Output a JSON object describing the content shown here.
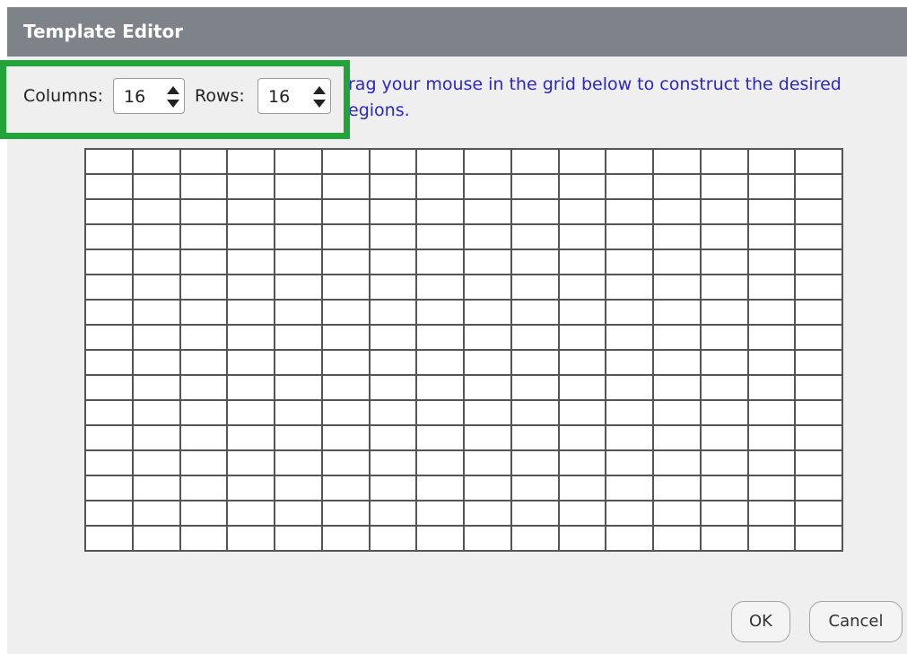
{
  "dialog": {
    "title": "Template Editor",
    "instruction": "rag your mouse in the grid below to construct the desired\negions."
  },
  "controls": {
    "columns_label": "Columns:",
    "columns_value": "16",
    "rows_label": "Rows:",
    "rows_value": "16"
  },
  "grid": {
    "columns": 16,
    "rows": 16
  },
  "buttons": {
    "ok": "OK",
    "cancel": "Cancel"
  },
  "colors": {
    "titlebar": "#7d8389",
    "dialog_bg": "#efefef",
    "highlight": "#22a43a",
    "instruction_text": "#2a26c9",
    "grid_lines": "#555555"
  }
}
